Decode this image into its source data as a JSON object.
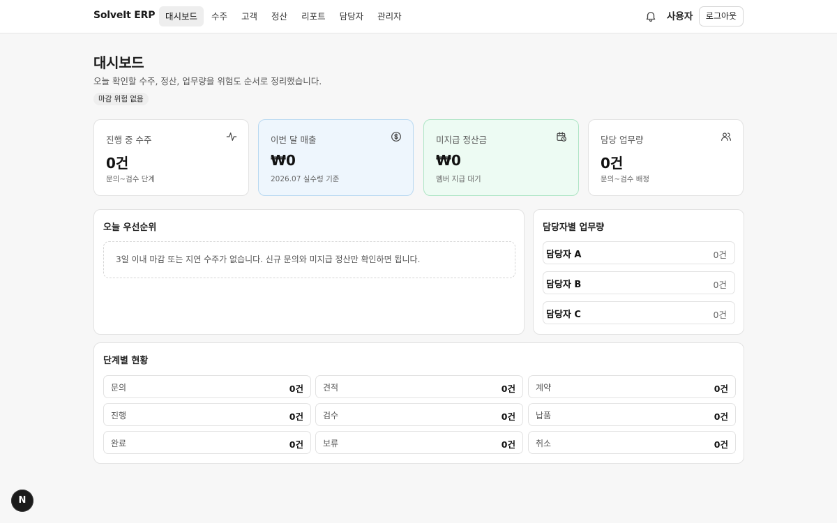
{
  "app": {
    "brand": "SolveIt ERP",
    "user": "사용자",
    "logout_label": "로그아웃"
  },
  "nav": [
    {
      "label": "대시보드",
      "active": true
    },
    {
      "label": "수주"
    },
    {
      "label": "고객"
    },
    {
      "label": "정산"
    },
    {
      "label": "리포트"
    },
    {
      "label": "담당자"
    },
    {
      "label": "관리자"
    }
  ],
  "header": {
    "title": "대시보드",
    "subtitle": "오늘 확인할 수주, 정산, 업무량을 위험도 순서로 정리했습니다.",
    "badge": "마감 위험 없음"
  },
  "stats": [
    {
      "label": "진행 중 수주",
      "value": "0건",
      "desc": "문의~검수 단계",
      "icon": "activity-icon"
    },
    {
      "label": "이번 달 매출",
      "value": "₩0",
      "desc": "2026.07 실수령 기준",
      "icon": "dollar-circle-icon"
    },
    {
      "label": "미지급 정산금",
      "value": "₩0",
      "desc": "멤버 지급 대기",
      "icon": "calendar-clock-icon"
    },
    {
      "label": "담당 업무량",
      "value": "0건",
      "desc": "문의~검수 배정",
      "icon": "users-icon"
    }
  ],
  "priority": {
    "title": "오늘 우선순위",
    "empty_message": "3일 이내 마감 또는 지연 수주가 없습니다. 신규 문의와 미지급 정산만 확인하면 됩니다."
  },
  "workload": {
    "title": "담당자별 업무량",
    "items": [
      {
        "name": "담당자 A",
        "count": "0건"
      },
      {
        "name": "담당자 B",
        "count": "0건"
      },
      {
        "name": "담당자 C",
        "count": "0건"
      }
    ]
  },
  "stages": {
    "title": "단계별 현황",
    "items": [
      {
        "label": "문의",
        "count": "0건"
      },
      {
        "label": "견적",
        "count": "0건"
      },
      {
        "label": "계약",
        "count": "0건"
      },
      {
        "label": "진행",
        "count": "0건"
      },
      {
        "label": "검수",
        "count": "0건"
      },
      {
        "label": "납품",
        "count": "0건"
      },
      {
        "label": "완료",
        "count": "0건"
      },
      {
        "label": "보류",
        "count": "0건"
      },
      {
        "label": "취소",
        "count": "0건"
      }
    ]
  },
  "floating_badge": "N",
  "colors": {
    "blue_card_bg": "#eef6fd",
    "green_card_bg": "#edfbf3"
  }
}
